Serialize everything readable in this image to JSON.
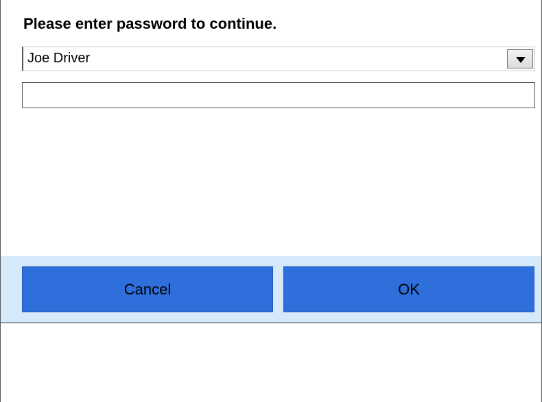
{
  "dialog": {
    "prompt": "Please enter password to continue.",
    "user_select": {
      "selected": "Joe Driver"
    },
    "password_field": {
      "value": "",
      "placeholder": ""
    },
    "buttons": {
      "cancel_label": "Cancel",
      "ok_label": "OK"
    }
  },
  "colors": {
    "button_fill": "#2f6fdb",
    "button_bar_background": "#d5e9fb"
  },
  "icons": {
    "dropdown": "triangle-down-icon"
  }
}
